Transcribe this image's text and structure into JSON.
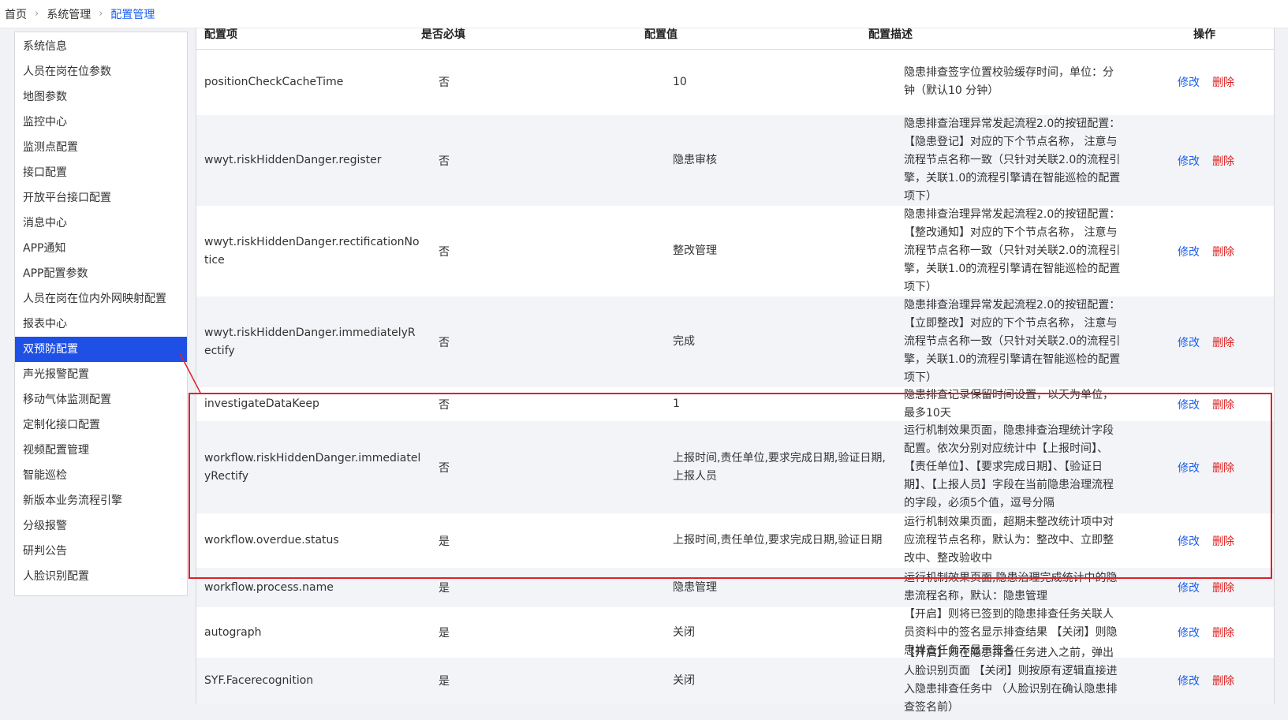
{
  "breadcrumb": {
    "home": "首页",
    "system": "系统管理",
    "current": "配置管理"
  },
  "sidebar": {
    "items": [
      {
        "label": "系统信息"
      },
      {
        "label": "人员在岗在位参数"
      },
      {
        "label": "地图参数"
      },
      {
        "label": "监控中心"
      },
      {
        "label": "监测点配置"
      },
      {
        "label": "接口配置"
      },
      {
        "label": "开放平台接口配置"
      },
      {
        "label": "消息中心"
      },
      {
        "label": "APP通知"
      },
      {
        "label": "APP配置参数"
      },
      {
        "label": "人员在岗在位内外网映射配置"
      },
      {
        "label": "报表中心"
      },
      {
        "label": "双预防配置"
      },
      {
        "label": "声光报警配置"
      },
      {
        "label": "移动气体监测配置"
      },
      {
        "label": "定制化接口配置"
      },
      {
        "label": "视频配置管理"
      },
      {
        "label": "智能巡检"
      },
      {
        "label": "新版本业务流程引擎"
      },
      {
        "label": "分级报警"
      },
      {
        "label": "研判公告"
      },
      {
        "label": "人脸识别配置"
      }
    ],
    "active_index": 12
  },
  "table": {
    "headers": {
      "key": "配置项",
      "required": "是否必填",
      "value": "配置值",
      "description": "配置描述",
      "actions": "操作"
    },
    "edit_label": "修改",
    "delete_label": "删除",
    "rows": [
      {
        "key": "positionCheckCacheTime",
        "required": "否",
        "value": "10",
        "description": "隐患排查签字位置校验缓存时间，单位：分钟（默认10 分钟）"
      },
      {
        "key": "wwyt.riskHiddenDanger.register",
        "required": "否",
        "value": "隐患审核",
        "description": "隐患排查治理异常发起流程2.0的按钮配置：【隐患登记】对应的下个节点名称， 注意与流程节点名称一致（只针对关联2.0的流程引擎，关联1.0的流程引擎请在智能巡检的配置项下）"
      },
      {
        "key": "wwyt.riskHiddenDanger.rectificationNotice",
        "required": "否",
        "value": "整改管理",
        "description": "隐患排查治理异常发起流程2.0的按钮配置：【整改通知】对应的下个节点名称， 注意与流程节点名称一致（只针对关联2.0的流程引擎，关联1.0的流程引擎请在智能巡检的配置项下）"
      },
      {
        "key": "wwyt.riskHiddenDanger.immediatelyRectify",
        "required": "否",
        "value": "完成",
        "description": "隐患排查治理异常发起流程2.0的按钮配置：【立即整改】对应的下个节点名称， 注意与流程节点名称一致（只针对关联2.0的流程引擎，关联1.0的流程引擎请在智能巡检的配置项下）"
      },
      {
        "key": "investigateDataKeep",
        "required": "否",
        "value": "1",
        "description": "隐患排查记录保留时间设置，以天为单位，最多10天"
      },
      {
        "key": "workflow.riskHiddenDanger.immediatelyRectify",
        "required": "否",
        "value": "上报时间,责任单位,要求完成日期,验证日期,上报人员",
        "description": "运行机制效果页面，隐患排查治理统计字段配置。依次分别对应统计中【上报时间】、【责任单位】、【要求完成日期】、【验证日期】、【上报人员】字段在当前隐患治理流程的字段，必须5个值，逗号分隔"
      },
      {
        "key": "workflow.overdue.status",
        "required": "是",
        "value": "上报时间,责任单位,要求完成日期,验证日期",
        "description": "运行机制效果页面，超期未整改统计项中对应流程节点名称，默认为：整改中、立即整改中、整改验收中"
      },
      {
        "key": "workflow.process.name",
        "required": "是",
        "value": "隐患管理",
        "description": "运行机制效果页面,隐患治理完成统计中的隐患流程名称，默认：隐患管理"
      },
      {
        "key": "autograph",
        "required": "是",
        "value": "关闭",
        "description": "【开启】则将已签到的隐患排查任务关联人员资料中的签名显示排查结果 【关闭】则隐患排查任务不显示签名"
      },
      {
        "key": "SYF.Facerecognition",
        "required": "是",
        "value": "关闭",
        "description": "【开启】则在隐患排查任务进入之前，弹出人脸识别页面 【关闭】则按原有逻辑直接进入隐患排查任务中 （人脸识别在确认隐患排查签名前）"
      }
    ]
  },
  "colors": {
    "accent": "#1e50e6",
    "link": "#1a5ff0",
    "danger": "#e02020",
    "highlight": "#e0202a"
  }
}
